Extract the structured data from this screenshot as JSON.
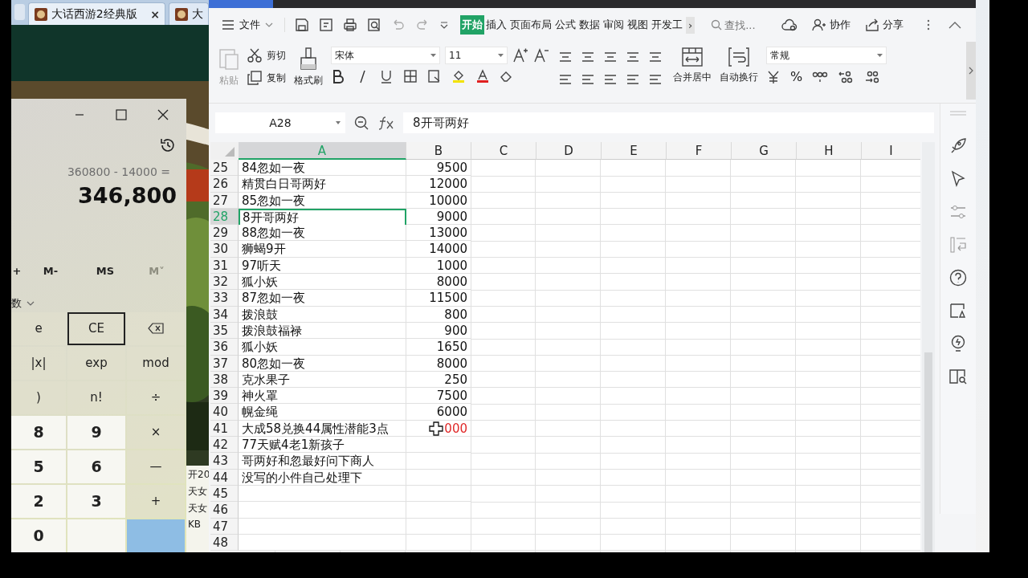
{
  "browser": {
    "tabs": [
      {
        "label": "大话西游2经典版",
        "selected": true,
        "close": "×"
      },
      {
        "label": "大",
        "selected": false
      }
    ],
    "page_texts": [
      "开20",
      "天女",
      "天女",
      "KB"
    ]
  },
  "calculator": {
    "expression": "360800 - 14000 =",
    "result": "346,800",
    "memory": [
      {
        "label": "+",
        "disabled": false
      },
      {
        "label": "M-",
        "disabled": false
      },
      {
        "label": "MS",
        "disabled": false
      },
      {
        "label": "M˅",
        "disabled": true
      }
    ],
    "mode_label": "数",
    "keys": [
      {
        "label": "e",
        "kind": "fn",
        "focused": false
      },
      {
        "label": "CE",
        "kind": "fn",
        "focused": true
      },
      {
        "kind": "backspace",
        "focused": false
      },
      {
        "label": "|x|",
        "kind": "fn",
        "focused": false
      },
      {
        "label": "exp",
        "kind": "fn",
        "focused": false
      },
      {
        "label": "mod",
        "kind": "fn",
        "focused": false
      },
      {
        "label": ")",
        "kind": "fn",
        "focused": false
      },
      {
        "label": "n!",
        "kind": "fn",
        "focused": false
      },
      {
        "label": "÷",
        "kind": "fn",
        "focused": false
      },
      {
        "label": "8",
        "kind": "digit",
        "focused": false
      },
      {
        "label": "9",
        "kind": "digit",
        "focused": false
      },
      {
        "label": "×",
        "kind": "fn",
        "focused": false
      },
      {
        "label": "5",
        "kind": "digit",
        "focused": false
      },
      {
        "label": "6",
        "kind": "digit",
        "focused": false
      },
      {
        "label": "—",
        "kind": "fn",
        "focused": false
      },
      {
        "label": "2",
        "kind": "digit",
        "focused": false
      },
      {
        "label": "3",
        "kind": "digit",
        "focused": false
      },
      {
        "label": "+",
        "kind": "fn",
        "focused": false
      },
      {
        "label": "0",
        "kind": "digit",
        "focused": false
      },
      {
        "kind": "digit",
        "focused": false
      },
      {
        "kind": "equals",
        "focused": false
      }
    ]
  },
  "spreadsheet": {
    "menu": {
      "file": "文件",
      "tabs": [
        {
          "label": "开始",
          "selected": true
        },
        {
          "label": "插入",
          "selected": false
        },
        {
          "label": "页面布局",
          "selected": false
        },
        {
          "label": "公式",
          "selected": false
        },
        {
          "label": "数据",
          "selected": false
        },
        {
          "label": "审阅",
          "selected": false
        },
        {
          "label": "视图",
          "selected": false
        },
        {
          "label": "开发工",
          "selected": false
        }
      ],
      "more": "›",
      "search": {
        "placeholder": "查找..."
      },
      "actions": [
        "协作",
        "分享"
      ]
    },
    "ribbon": {
      "paste": "粘贴",
      "cut": "剪切",
      "copy": "复制",
      "format_painter": "格式刷",
      "font": "宋体",
      "font_size": "11",
      "merge": "合并居中",
      "wrap": "自动换行",
      "number_format": "常规",
      "percent": "%"
    },
    "formula_bar": {
      "cell": "A28",
      "formula": "8开哥两好"
    },
    "columns": [
      {
        "label": "A",
        "selected": true
      },
      {
        "label": "B",
        "selected": false
      },
      {
        "label": "C",
        "selected": false
      },
      {
        "label": "D",
        "selected": false
      },
      {
        "label": "E",
        "selected": false
      },
      {
        "label": "F",
        "selected": false
      },
      {
        "label": "G",
        "selected": false
      },
      {
        "label": "H",
        "selected": false
      },
      {
        "label": "I",
        "selected": false
      }
    ],
    "rows": [
      {
        "number": "25",
        "a": "84忽如一夜",
        "b": "9500",
        "selected": false
      },
      {
        "number": "26",
        "a": "精贯白日哥两好",
        "b": "12000",
        "selected": false
      },
      {
        "number": "27",
        "a": "85忽如一夜",
        "b": "10000",
        "selected": false
      },
      {
        "number": "28",
        "a": "8开哥两好",
        "b": "9000",
        "selected": true
      },
      {
        "number": "29",
        "a": "88忽如一夜",
        "b": "13000",
        "selected": false
      },
      {
        "number": "30",
        "a": "狮蝎9开",
        "b": "14000",
        "selected": false
      },
      {
        "number": "31",
        "a": "97听天",
        "b": "1000",
        "selected": false
      },
      {
        "number": "32",
        "a": "狐小妖",
        "b": "8000",
        "selected": false
      },
      {
        "number": "33",
        "a": "87忽如一夜",
        "b": "11500",
        "selected": false
      },
      {
        "number": "34",
        "a": "拨浪鼓",
        "b": "800",
        "selected": false
      },
      {
        "number": "35",
        "a": "拨浪鼓福禄",
        "b": "900",
        "selected": false
      },
      {
        "number": "36",
        "a": "狐小妖",
        "b": "1650",
        "selected": false
      },
      {
        "number": "37",
        "a": "80忽如一夜",
        "b": "8000",
        "selected": false
      },
      {
        "number": "38",
        "a": "克水果子",
        "b": "250",
        "selected": false
      },
      {
        "number": "39",
        "a": "神火罩",
        "b": "7500",
        "selected": false
      },
      {
        "number": "40",
        "a": "幌金绳",
        "b": "6000",
        "selected": false
      },
      {
        "number": "41",
        "a": "大成58兑换44属性潜能3点",
        "b": "000",
        "color": "#e02828",
        "pointer": true,
        "selected": false
      },
      {
        "number": "42",
        "a": "77天赋4老1新孩子",
        "selected": false
      },
      {
        "number": "43",
        "a": "哥两好和忽最好问下商人",
        "selected": false
      },
      {
        "number": "44",
        "a": "没写的小件自己处理下",
        "selected": false
      },
      {
        "number": "45",
        "selected": false
      },
      {
        "number": "46",
        "selected": false
      },
      {
        "number": "47",
        "selected": false
      },
      {
        "number": "48",
        "selected": false
      }
    ]
  }
}
